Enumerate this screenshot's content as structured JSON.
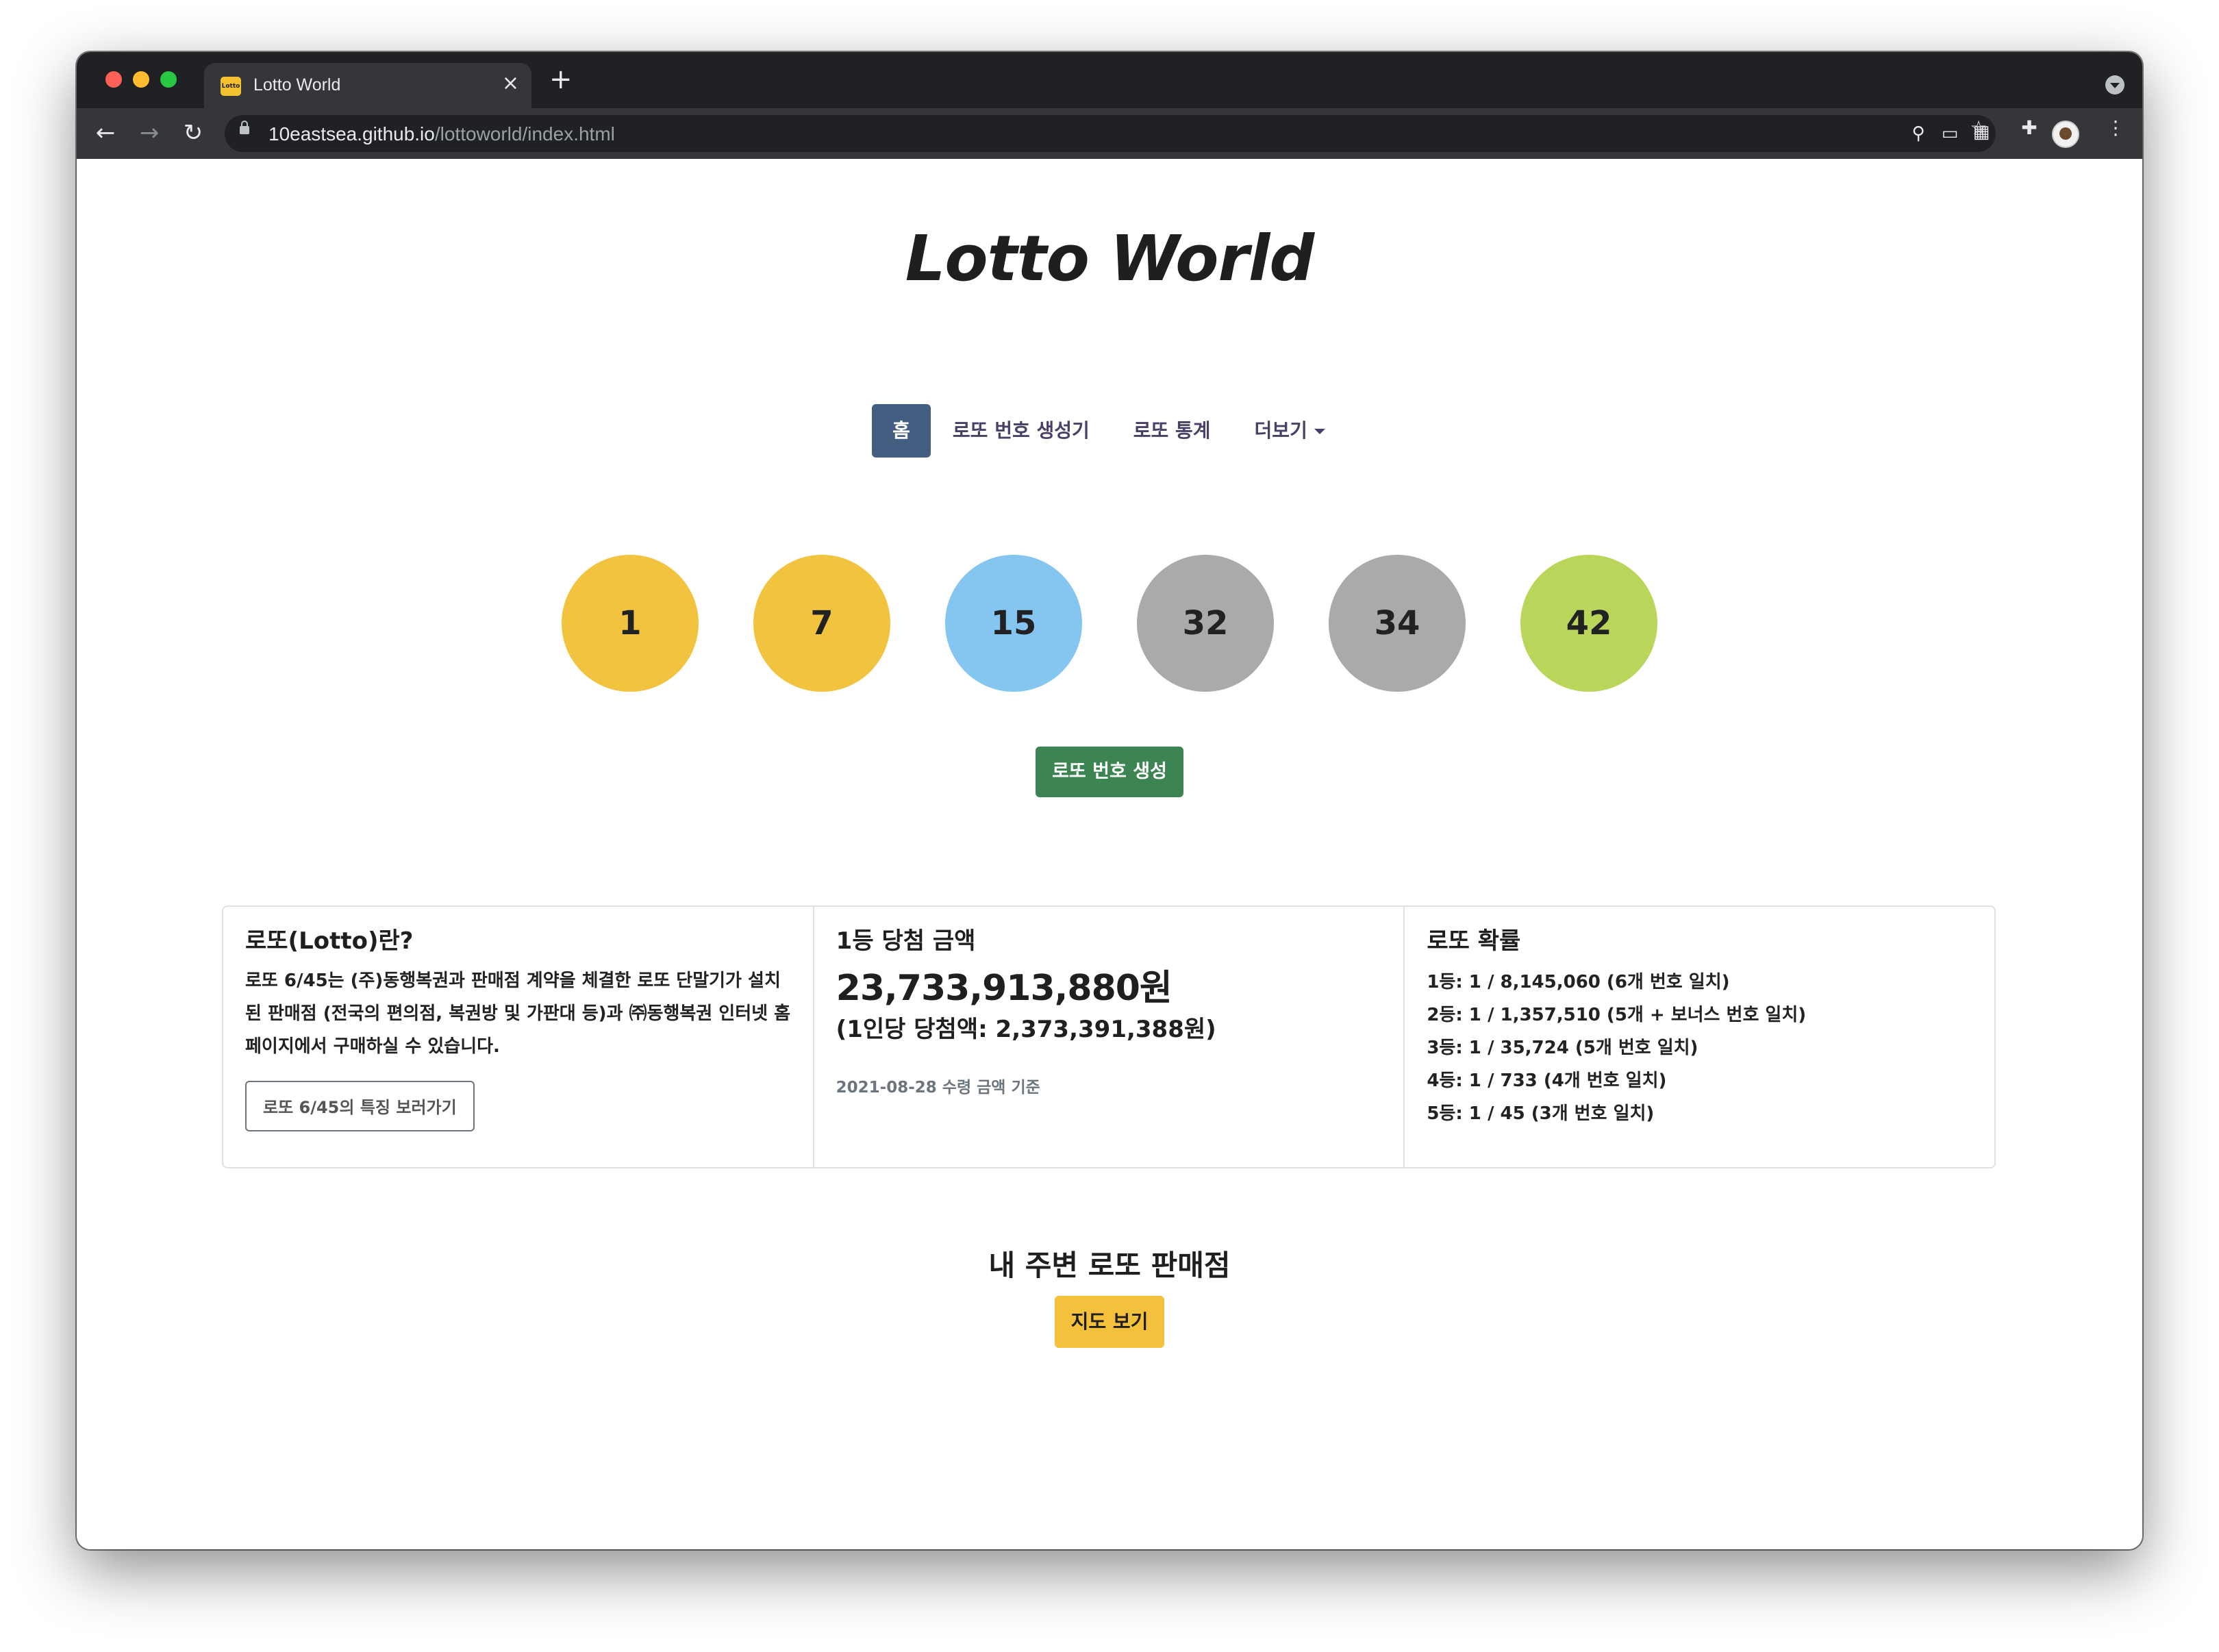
{
  "browser": {
    "tab_title": "Lotto World",
    "tab_favicon_text": "Lotto",
    "new_tab": "+",
    "close_tab": "×",
    "url_host": "10eastsea.github.io",
    "url_path": "/lottoworld/index.html",
    "icons": {
      "back": "←",
      "forward": "→",
      "reload": "↻",
      "location": "⚲",
      "cast": "▭",
      "qr": "▦",
      "bookmark": "☆",
      "extensions": "✚",
      "menu": "⋮"
    }
  },
  "site": {
    "title": "Lotto World"
  },
  "nav": {
    "items": [
      {
        "label": "홈",
        "active": true
      },
      {
        "label": "로또 번호 생성기"
      },
      {
        "label": "로또 통계"
      },
      {
        "label": "더보기"
      }
    ]
  },
  "balls": [
    {
      "number": "1",
      "color": "#f1c33f"
    },
    {
      "number": "7",
      "color": "#f1c33f"
    },
    {
      "number": "15",
      "color": "#84c6ef"
    },
    {
      "number": "32",
      "color": "#aaaaaa"
    },
    {
      "number": "34",
      "color": "#aaaaaa"
    },
    {
      "number": "42",
      "color": "#b9d65a"
    }
  ],
  "generate_button": "로또 번호 생성",
  "cards": {
    "about": {
      "title": "로또(Lotto)란?",
      "text": "로또 6/45는 (주)동행복권과 판매점 계약을 체결한 로또 단말기가 설치된 판매점 (전국의 편의점, 복권방 및 가판대 등)과 ㈜동행복권 인터넷 홈페이지에서 구매하실 수 있습니다.",
      "button": "로또 6/45의 특징 보러가기"
    },
    "prize": {
      "title": "1등 당첨 금액",
      "amount": "23,733,913,880원",
      "per_person": "(1인당 당첨액: 2,373,391,388원)",
      "date_note": "2021-08-28 수령 금액 기준"
    },
    "probability": {
      "title": "로또 확률",
      "items": [
        "1등: 1 / 8,145,060 (6개 번호 일치)",
        "2등: 1 / 1,357,510 (5개 + 보너스 번호 일치)",
        "3등: 1 / 35,724 (5개 번호 일치)",
        "4등: 1 / 733 (4개 번호 일치)",
        "5등: 1 / 45 (3개 번호 일치)"
      ]
    }
  },
  "store": {
    "title": "내 주변 로또 판매점",
    "button": "지도 보기"
  },
  "colors": {
    "nav_active": "#435e80",
    "generate": "#3c8451",
    "map": "#f4c13d"
  }
}
